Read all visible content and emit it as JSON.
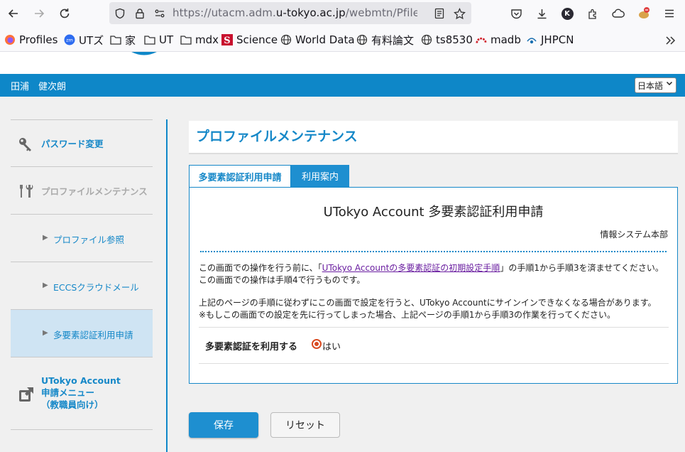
{
  "browser": {
    "url_prefix": "https://utacm.adm.",
    "url_host": "u-tokyo.ac.jp",
    "url_rest": "/webmtn/Pfilemtn",
    "bookmarks": [
      "Profiles",
      "UTズ",
      "家",
      "UT",
      "mdx",
      "Science",
      "World Data",
      "有料論文",
      "ts8530",
      "madb",
      "JHPCN"
    ],
    "profile_initial": "K"
  },
  "header": {
    "user_name": "田浦　健次朗",
    "language": "日本語"
  },
  "sidebar": {
    "items": [
      {
        "label": "パスワード変更"
      },
      {
        "label": "プロファイルメンテナンス"
      },
      {
        "label": "プロファイル参照"
      },
      {
        "label": "ECCSクラウドメール"
      },
      {
        "label": "多要素認証利用申請"
      },
      {
        "label_lines": [
          "UTokyo Account",
          "申請メニュー",
          "（教職員向け）"
        ]
      }
    ]
  },
  "main": {
    "page_title": "プロファイルメンテナンス",
    "tabs": [
      {
        "label": "多要素認証利用申請"
      },
      {
        "label": "利用案内"
      }
    ],
    "panel": {
      "title": "UTokyo Account 多要素認証利用申請",
      "department": "情報システム本部",
      "para1_line1_before": "この画面での操作を行う前に、「",
      "para1_link": "UTokyo Accountの多要素認証の初期設定手順",
      "para1_line1_after": "」の手順1から手順3を済ませてください。",
      "para1_line2": "この画面での操作は手順4で行うものです。",
      "para2_line1": "上記のページの手順に従わずにこの画面で設定を行うと、UTokyo Accountにサインインできなくなる場合があります。",
      "para2_line2": "※もしこの画面での設定を先に行ってしまった場合、上記ページの手順1から手順3の作業を行ってください。",
      "field_label": "多要素認証を利用する",
      "option_label": "はい",
      "option_selected": true
    },
    "buttons": {
      "save": "保存",
      "reset": "リセット"
    }
  }
}
